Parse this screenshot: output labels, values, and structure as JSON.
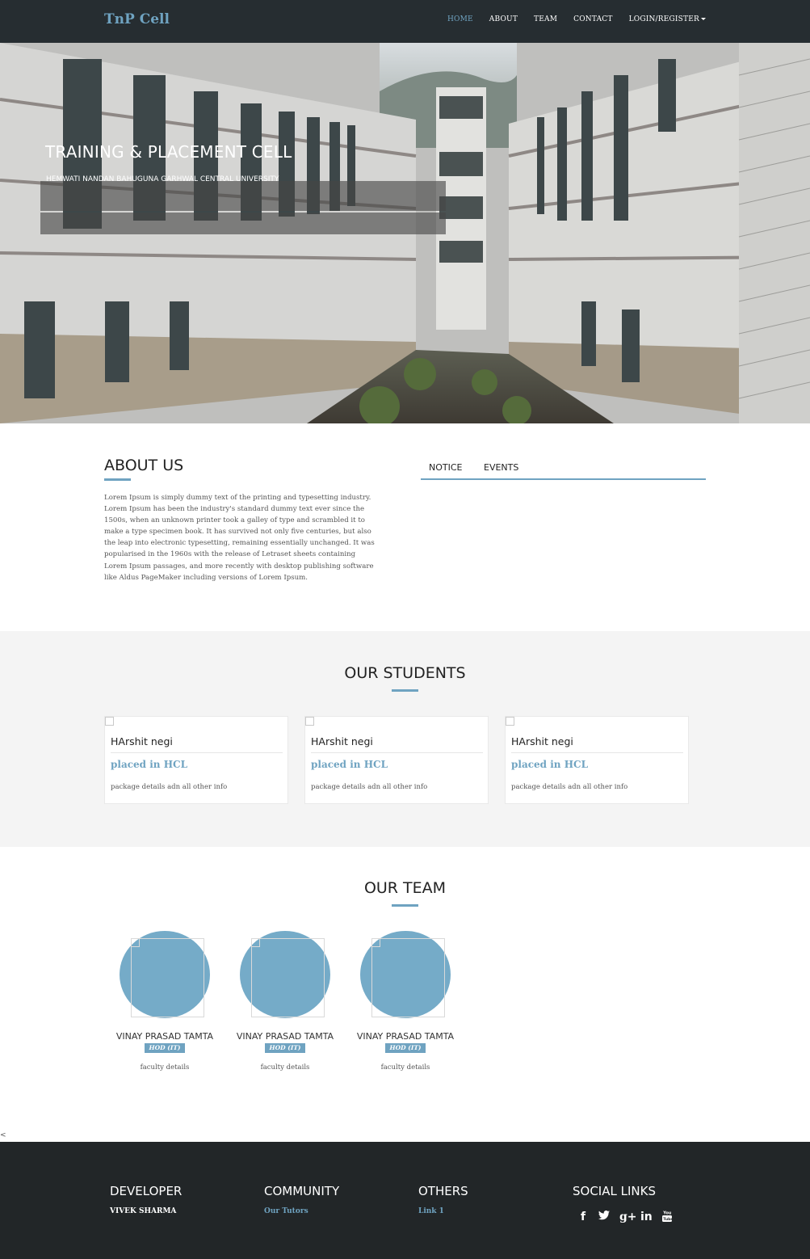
{
  "navbar": {
    "brand": "TnP Cell",
    "items": [
      {
        "label": "HOME",
        "active": true
      },
      {
        "label": "ABOUT",
        "active": false
      },
      {
        "label": "TEAM",
        "active": false
      },
      {
        "label": "CONTACT",
        "active": false
      },
      {
        "label": "LOGIN/REGISTER",
        "active": false,
        "dropdown": true
      }
    ]
  },
  "hero": {
    "title": "TRAINING & PLACEMENT CELL",
    "subtitle": "HEMWATI NANDAN BAHUGUNA GARHWAL CENTRAL UNIVERSITY"
  },
  "about": {
    "title": "ABOUT US",
    "text": "Lorem Ipsum is simply dummy text of the printing and typesetting industry. Lorem Ipsum has been the industry's standard dummy text ever since the 1500s, when an unknown printer took a galley of type and scrambled it to make a type specimen book. It has survived not only five centuries, but also the leap into electronic typesetting, remaining essentially unchanged. It was popularised in the 1960s with the release of Letraset sheets containing Lorem Ipsum passages, and more recently with desktop publishing software like Aldus PageMaker including versions of Lorem Ipsum.",
    "tabs": [
      "NOTICE",
      "EVENTS"
    ]
  },
  "students": {
    "title": "OUR STUDENTS",
    "cards": [
      {
        "name": "HArshit negi",
        "placed": "placed in HCL",
        "details": "package details adn all other info"
      },
      {
        "name": "HArshit negi",
        "placed": "placed in HCL",
        "details": "package details adn all other info"
      },
      {
        "name": "HArshit negi",
        "placed": "placed in HCL",
        "details": "package details adn all other info"
      }
    ]
  },
  "team": {
    "title": "OUR TEAM",
    "members": [
      {
        "name": "VINAY PRASAD TAMTA",
        "role": "HOD (IT)",
        "details": "faculty details"
      },
      {
        "name": "VINAY PRASAD TAMTA",
        "role": "HOD (IT)",
        "details": "faculty details"
      },
      {
        "name": "VINAY PRASAD TAMTA",
        "role": "HOD (IT)",
        "details": "faculty details"
      }
    ]
  },
  "stray_char": "<",
  "footer": {
    "developer": {
      "heading": "DEVELOPER",
      "item": "VIVEK SHARMA"
    },
    "community": {
      "heading": "COMMUNITY",
      "item": "Our Tutors"
    },
    "others": {
      "heading": "OTHERS",
      "item": "Link 1"
    },
    "social": {
      "heading": "SOCIAL LINKS",
      "icons": [
        "facebook-icon",
        "twitter-icon",
        "google-plus-icon",
        "linkedin-icon",
        "youtube-icon"
      ]
    }
  },
  "colors": {
    "accent": "#6fa3c1",
    "navbar": "#262d31",
    "footer": "#222628",
    "section_alt": "#f4f4f4"
  }
}
